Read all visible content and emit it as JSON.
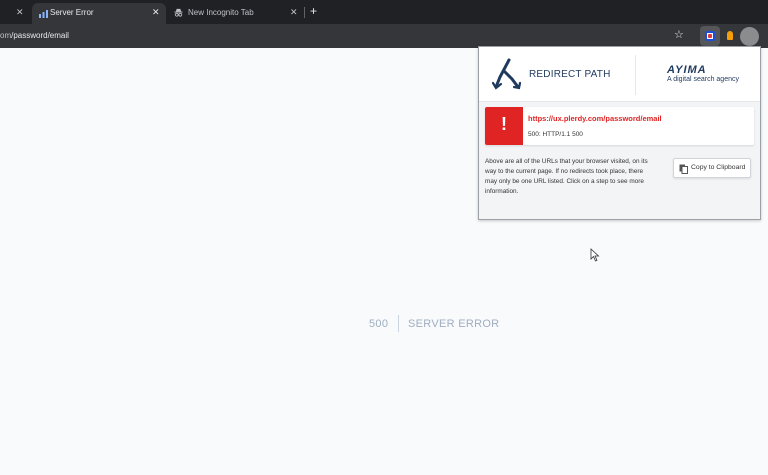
{
  "browser": {
    "tabs": [
      {
        "title": "",
        "close": "✕"
      },
      {
        "title": "Server Error",
        "close": "✕",
        "active": true
      },
      {
        "title": "New Incognito Tab",
        "close": "✕"
      }
    ],
    "new_tab": "+",
    "url_host_tail": "om",
    "url_path": "/password/email",
    "star": "☆"
  },
  "page": {
    "error_code": "500",
    "error_message": "SERVER ERROR"
  },
  "popup": {
    "brand": "REDIRECT PATH",
    "partner": "AYIMA",
    "partner_tagline": "A digital search agency",
    "step": {
      "icon": "!",
      "url": "https://ux.plerdy.com/password/email",
      "status": "500: HTTP/1.1 500"
    },
    "help_text": "Above are all of the URLs that your browser visited, on its way to the current page. If no redirects took place, there may only be one URL listed. Click on a step to see more information.",
    "copy_button": "Copy to Clipboard"
  },
  "colors": {
    "accent_error": "#e02424",
    "brand_navy": "#1f3a5f",
    "chrome_dark": "#202124",
    "chrome_toolbar": "#35363a"
  },
  "icons": [
    "close-icon",
    "bars-favicon-icon",
    "incognito-icon",
    "plus-icon",
    "star-icon",
    "redirect-path-extension-icon",
    "extension-icon",
    "profile-avatar",
    "redirect-path-logo-icon",
    "error-icon",
    "clipboard-icon",
    "mouse-cursor-icon"
  ]
}
